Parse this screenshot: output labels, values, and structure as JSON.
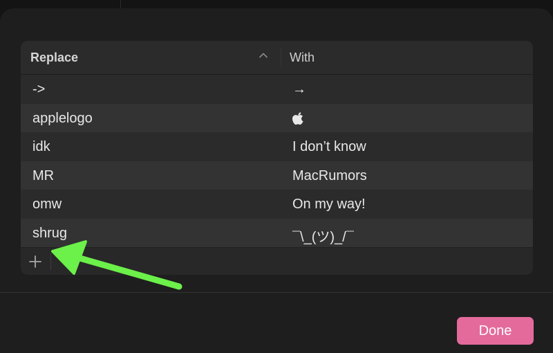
{
  "table": {
    "headers": {
      "replace": "Replace",
      "with": "With"
    },
    "rows": [
      {
        "replace": "->",
        "with": "→"
      },
      {
        "replace": "applelogo",
        "with": ""
      },
      {
        "replace": "idk",
        "with": "I don’t know"
      },
      {
        "replace": "MR",
        "with": "MacRumors"
      },
      {
        "replace": "omw",
        "with": "On my way!"
      },
      {
        "replace": "shrug",
        "with": "¯\\_(ツ)_/¯"
      }
    ],
    "sort_indicator": "chevron-up-icon",
    "add_icon": "plus-icon"
  },
  "footer": {
    "done_label": "Done"
  },
  "annotation": {
    "arrow_icon": "green-arrow-icon",
    "color": "#6cf04a"
  },
  "colors": {
    "accent": "#e46a9c"
  }
}
